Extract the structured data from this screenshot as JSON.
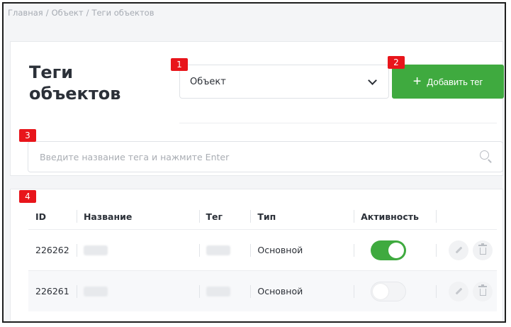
{
  "breadcrumb": {
    "items": [
      "Главная",
      "/",
      "Объект",
      "/",
      "Теги объектов"
    ]
  },
  "header": {
    "title": "Теги объектов",
    "select_value": "Объект",
    "add_button_label": "Добавить тег",
    "add_button_icon": "+"
  },
  "search": {
    "placeholder": "Введите название тега и нажмите Enter"
  },
  "badges": [
    "1",
    "2",
    "3",
    "4"
  ],
  "table": {
    "columns": [
      "ID",
      "Название",
      "Тег",
      "Тип",
      "Активность"
    ],
    "rows": [
      {
        "id": "226262",
        "type": "Основной",
        "active": true
      },
      {
        "id": "226261",
        "type": "Основной",
        "active": false
      }
    ]
  },
  "colors": {
    "accent_green": "#3faa3f",
    "badge_red": "#e8151b"
  }
}
